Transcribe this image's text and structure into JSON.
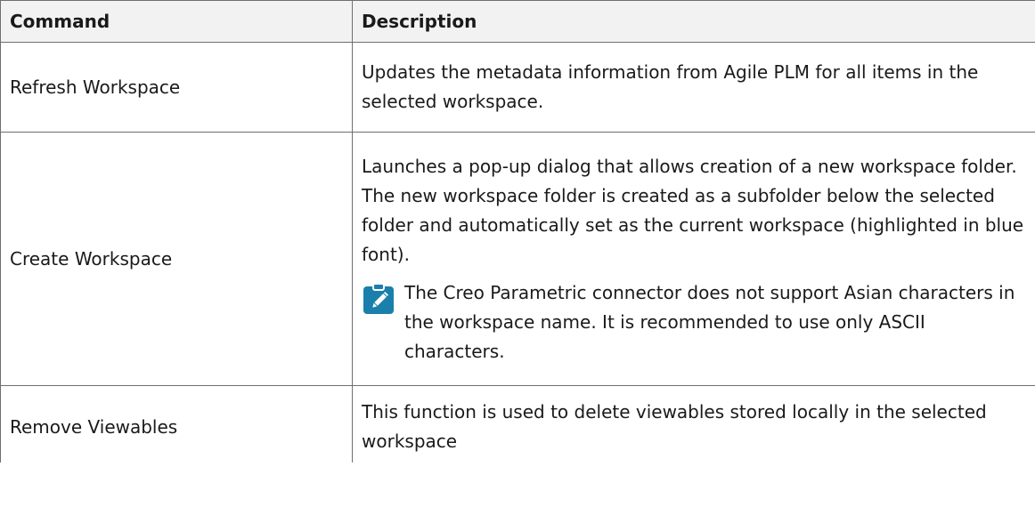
{
  "table": {
    "headers": {
      "command": "Command",
      "description": "Description"
    },
    "rows": [
      {
        "command": "Refresh Workspace",
        "description": "Updates the metadata information from Agile PLM for all items in the selected workspace."
      },
      {
        "command": "Create Workspace",
        "description": "Launches a pop-up dialog that allows creation of a new workspace folder. The new workspace folder is created as a subfolder below the selected folder and automatically set as the current workspace (highlighted in blue font).",
        "note": "The Creo Parametric connector does not support Asian characters in the workspace name. It is recommended to use only ASCII characters.",
        "note_icon": "pencil-note-icon"
      },
      {
        "command": "Remove Viewables",
        "description": "This function is used to delete viewables stored locally in the selected workspace"
      }
    ]
  },
  "colors": {
    "note_icon": "#1a7fab",
    "border": "#6f6f6f",
    "header_bg": "#f2f2f2",
    "text": "#1a1a1a"
  }
}
